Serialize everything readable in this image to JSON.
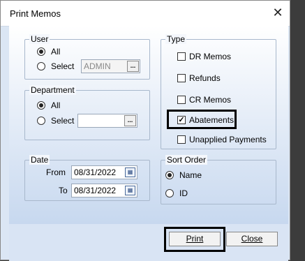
{
  "dialog": {
    "title": "Print Memos",
    "close_icon": "close-icon"
  },
  "user": {
    "legend": "User",
    "option_all": "All",
    "option_select": "Select",
    "selected_option": "All",
    "value": "ADMIN",
    "browse_label": "..."
  },
  "department": {
    "legend": "Department",
    "option_all": "All",
    "option_select": "Select",
    "selected_option": "All",
    "value": "",
    "browse_label": "..."
  },
  "date": {
    "legend": "Date",
    "from_label": "From",
    "from_value": "08/31/2022",
    "to_label": "To",
    "to_value": "08/31/2022"
  },
  "type": {
    "legend": "Type",
    "items": [
      {
        "label": "DR Memos",
        "checked": false
      },
      {
        "label": "Refunds",
        "checked": false
      },
      {
        "label": "CR Memos",
        "checked": false
      },
      {
        "label": "Abatements",
        "checked": true
      },
      {
        "label": "Unapplied Payments",
        "checked": false
      }
    ]
  },
  "sort_order": {
    "legend": "Sort Order",
    "option_name": "Name",
    "option_id": "ID",
    "selected_option": "Name"
  },
  "buttons": {
    "print": "Print",
    "close": "Close"
  },
  "colors": {
    "dialog_bg": "#dbe6f4",
    "highlight": "#000000"
  }
}
